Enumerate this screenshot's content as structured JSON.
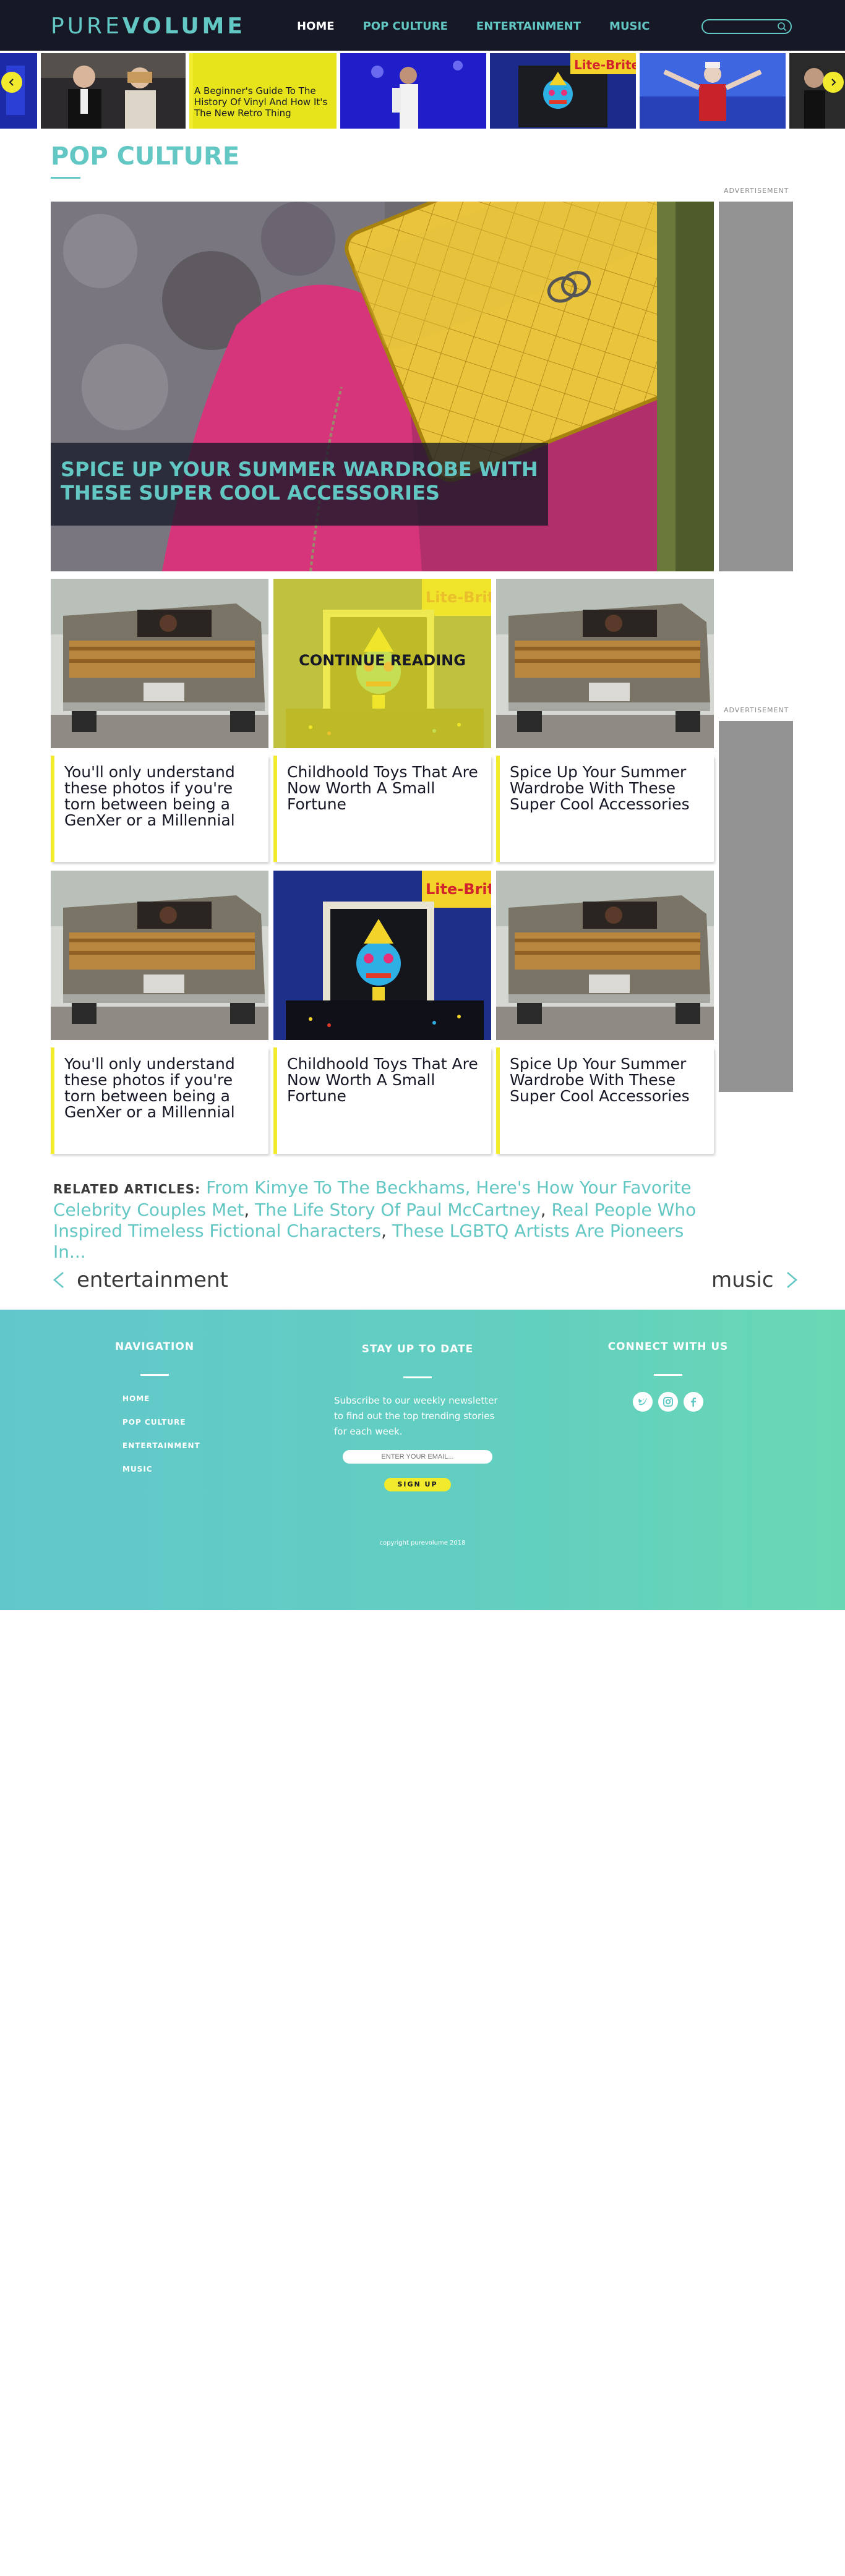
{
  "brand": {
    "logo_light": "PURE",
    "logo_bold": "VOLUME"
  },
  "nav": [
    {
      "label": "HOME",
      "active": true
    },
    {
      "label": "POP CULTURE",
      "active": false
    },
    {
      "label": "ENTERTAINMENT",
      "active": false
    },
    {
      "label": "MUSIC",
      "active": false
    }
  ],
  "search": {
    "placeholder": ""
  },
  "carousel": {
    "slide_text": "A Beginner's Guide To The History Of Vinyl And How It's The New Retro Thing"
  },
  "section": {
    "title": "POP CULTURE"
  },
  "hero": {
    "title": "SPICE UP YOUR SUMMER WARDROBE WITH THESE SUPER COOL ACCESSORIES"
  },
  "ads": {
    "label": "ADVERTISEMENT"
  },
  "cards": [
    {
      "title": "You'll only understand these photos if you're torn between being a GenXer or a Millennial",
      "image": "station-wagon"
    },
    {
      "title": "Childhoold Toys That Are Now Worth A Small Fortune",
      "image": "lite-brite",
      "overlay": "CONTINUE READING"
    },
    {
      "title": "Spice Up Your Summer Wardrobe With These Super Cool Accessories",
      "image": "station-wagon"
    },
    {
      "title": "You'll only understand these photos if you're torn between being a GenXer or a Millennial",
      "image": "station-wagon"
    },
    {
      "title": "Childhoold Toys That Are Now Worth A Small Fortune",
      "image": "lite-brite"
    },
    {
      "title": "Spice Up Your Summer Wardrobe With These Super Cool Accessories",
      "image": "station-wagon"
    }
  ],
  "related": {
    "label": "RELATED ARTICLES:",
    "links": [
      "From Kimye To The Beckhams, Here's How Your Favorite Celebrity Couples Met",
      "The Life Story Of Paul McCartney",
      "Real People Who Inspired Timeless Fictional Characters",
      "These LGBTQ Artists Are Pioneers In..."
    ]
  },
  "pager": {
    "prev": "entertainment",
    "next": "music"
  },
  "footer": {
    "nav_heading": "NAVIGATION",
    "nav_links": [
      "HOME",
      "POP CULTURE",
      "ENTERTAINMENT",
      "MUSIC"
    ],
    "newsletter_heading": "STAY UP TO DATE",
    "newsletter_text": "Subscribe to our weekly newsletter to find out the top trending stories for each week.",
    "email_placeholder": "ENTER YOUR EMAIL...",
    "signup_label": "SIGN UP",
    "connect_heading": "CONNECT WITH US",
    "social": [
      "twitter-icon",
      "instagram-icon",
      "facebook-icon"
    ],
    "copyright": "copyright purevolume 2018"
  },
  "colors": {
    "brand": "#63c7c4",
    "header_bg": "#161826",
    "accent_yellow": "#f2ea2c",
    "ad_gray": "#939393"
  }
}
